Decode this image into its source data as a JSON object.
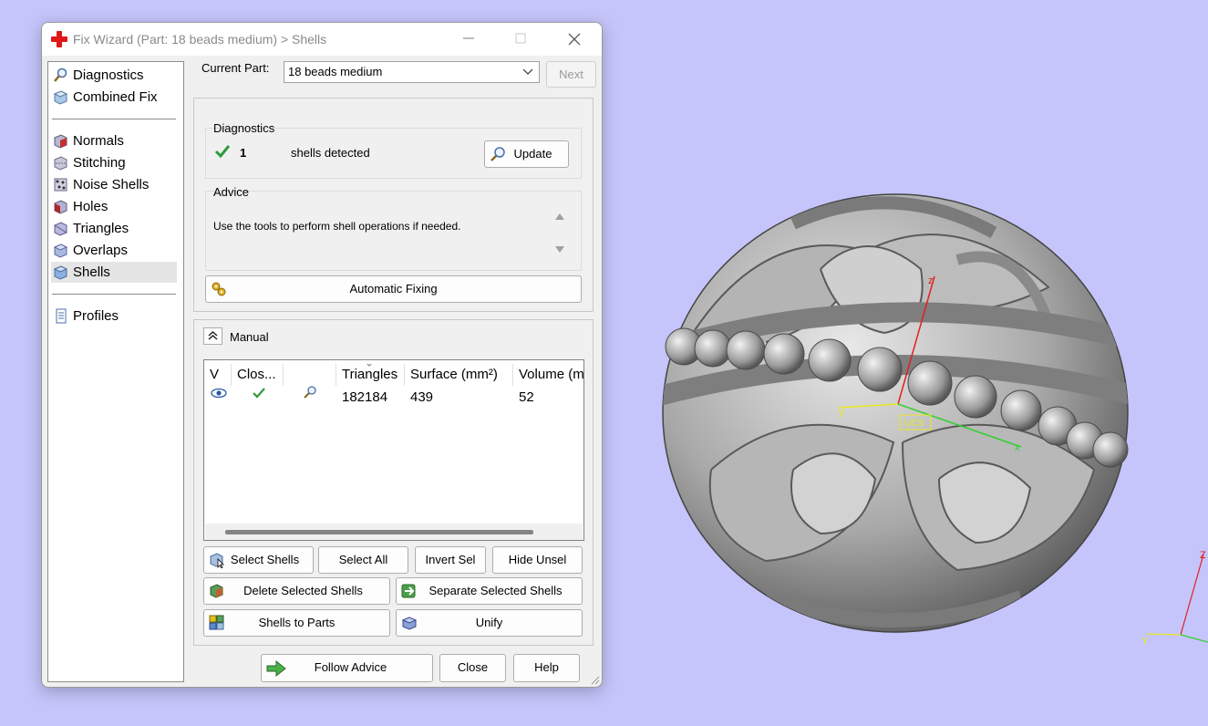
{
  "window": {
    "title": "Fix Wizard (Part: 18 beads medium) > Shells"
  },
  "nav": {
    "items_top": [
      {
        "label": "Diagnostics",
        "icon": "magnifier-icon"
      },
      {
        "label": "Combined Fix",
        "icon": "cube-icon"
      }
    ],
    "items_mid": [
      {
        "label": "Normals",
        "icon": "normals-cube-icon"
      },
      {
        "label": "Stitching",
        "icon": "stitching-cube-icon"
      },
      {
        "label": "Noise Shells",
        "icon": "noise-shells-icon"
      },
      {
        "label": "Holes",
        "icon": "holes-cube-icon"
      },
      {
        "label": "Triangles",
        "icon": "triangles-cube-icon"
      },
      {
        "label": "Overlaps",
        "icon": "overlaps-cube-icon"
      },
      {
        "label": "Shells",
        "icon": "shells-cube-icon"
      }
    ],
    "items_bottom": [
      {
        "label": "Profiles",
        "icon": "document-icon"
      }
    ]
  },
  "current_part": {
    "label": "Current Part:",
    "value": "18 beads medium",
    "next_label": "Next"
  },
  "diagnostics": {
    "title": "Diagnostics",
    "count": "1",
    "status": "shells detected",
    "update_label": "Update"
  },
  "advice": {
    "title": "Advice",
    "text": "Use the tools to perform shell operations if needed."
  },
  "auto_fix_label": "Automatic Fixing",
  "manual": {
    "title": "Manual",
    "columns": [
      "V",
      "Clos...",
      "",
      "Triangles",
      "Surface (mm²)",
      "Volume (m"
    ],
    "rows": [
      {
        "triangles": "182184",
        "surface": "439",
        "volume": "52"
      }
    ]
  },
  "buttons": {
    "select_shells": "Select Shells",
    "select_all": "Select All",
    "invert_sel": "Invert Sel",
    "hide_unsel": "Hide Unsel",
    "delete_selected": "Delete Selected Shells",
    "separate_selected": "Separate Selected Shells",
    "shells_to_parts": "Shells to Parts",
    "unify": "Unify",
    "follow_advice": "Follow Advice",
    "close": "Close",
    "help": "Help"
  },
  "viewport": {
    "ucs_label": "UCS",
    "axis_x": "x",
    "axis_y": "y",
    "axis_z": "z",
    "corner_axis_y": "Y",
    "corner_axis_z": "Z"
  },
  "colors": {
    "viewport_bg": "#c5c5fb",
    "accent_red": "#e01818",
    "check_green": "#2e9a3a"
  }
}
